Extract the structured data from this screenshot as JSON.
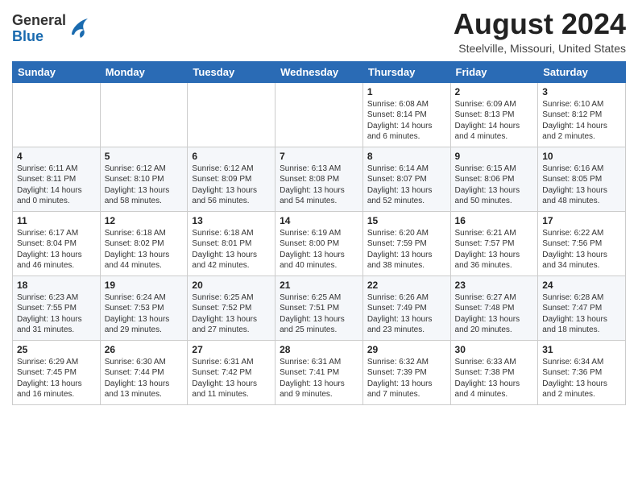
{
  "header": {
    "logo_general": "General",
    "logo_blue": "Blue",
    "title": "August 2024",
    "location": "Steelville, Missouri, United States"
  },
  "days_of_week": [
    "Sunday",
    "Monday",
    "Tuesday",
    "Wednesday",
    "Thursday",
    "Friday",
    "Saturday"
  ],
  "weeks": [
    [
      {
        "day": "",
        "text": ""
      },
      {
        "day": "",
        "text": ""
      },
      {
        "day": "",
        "text": ""
      },
      {
        "day": "",
        "text": ""
      },
      {
        "day": "1",
        "text": "Sunrise: 6:08 AM\nSunset: 8:14 PM\nDaylight: 14 hours and 6 minutes."
      },
      {
        "day": "2",
        "text": "Sunrise: 6:09 AM\nSunset: 8:13 PM\nDaylight: 14 hours and 4 minutes."
      },
      {
        "day": "3",
        "text": "Sunrise: 6:10 AM\nSunset: 8:12 PM\nDaylight: 14 hours and 2 minutes."
      }
    ],
    [
      {
        "day": "4",
        "text": "Sunrise: 6:11 AM\nSunset: 8:11 PM\nDaylight: 14 hours and 0 minutes."
      },
      {
        "day": "5",
        "text": "Sunrise: 6:12 AM\nSunset: 8:10 PM\nDaylight: 13 hours and 58 minutes."
      },
      {
        "day": "6",
        "text": "Sunrise: 6:12 AM\nSunset: 8:09 PM\nDaylight: 13 hours and 56 minutes."
      },
      {
        "day": "7",
        "text": "Sunrise: 6:13 AM\nSunset: 8:08 PM\nDaylight: 13 hours and 54 minutes."
      },
      {
        "day": "8",
        "text": "Sunrise: 6:14 AM\nSunset: 8:07 PM\nDaylight: 13 hours and 52 minutes."
      },
      {
        "day": "9",
        "text": "Sunrise: 6:15 AM\nSunset: 8:06 PM\nDaylight: 13 hours and 50 minutes."
      },
      {
        "day": "10",
        "text": "Sunrise: 6:16 AM\nSunset: 8:05 PM\nDaylight: 13 hours and 48 minutes."
      }
    ],
    [
      {
        "day": "11",
        "text": "Sunrise: 6:17 AM\nSunset: 8:04 PM\nDaylight: 13 hours and 46 minutes."
      },
      {
        "day": "12",
        "text": "Sunrise: 6:18 AM\nSunset: 8:02 PM\nDaylight: 13 hours and 44 minutes."
      },
      {
        "day": "13",
        "text": "Sunrise: 6:18 AM\nSunset: 8:01 PM\nDaylight: 13 hours and 42 minutes."
      },
      {
        "day": "14",
        "text": "Sunrise: 6:19 AM\nSunset: 8:00 PM\nDaylight: 13 hours and 40 minutes."
      },
      {
        "day": "15",
        "text": "Sunrise: 6:20 AM\nSunset: 7:59 PM\nDaylight: 13 hours and 38 minutes."
      },
      {
        "day": "16",
        "text": "Sunrise: 6:21 AM\nSunset: 7:57 PM\nDaylight: 13 hours and 36 minutes."
      },
      {
        "day": "17",
        "text": "Sunrise: 6:22 AM\nSunset: 7:56 PM\nDaylight: 13 hours and 34 minutes."
      }
    ],
    [
      {
        "day": "18",
        "text": "Sunrise: 6:23 AM\nSunset: 7:55 PM\nDaylight: 13 hours and 31 minutes."
      },
      {
        "day": "19",
        "text": "Sunrise: 6:24 AM\nSunset: 7:53 PM\nDaylight: 13 hours and 29 minutes."
      },
      {
        "day": "20",
        "text": "Sunrise: 6:25 AM\nSunset: 7:52 PM\nDaylight: 13 hours and 27 minutes."
      },
      {
        "day": "21",
        "text": "Sunrise: 6:25 AM\nSunset: 7:51 PM\nDaylight: 13 hours and 25 minutes."
      },
      {
        "day": "22",
        "text": "Sunrise: 6:26 AM\nSunset: 7:49 PM\nDaylight: 13 hours and 23 minutes."
      },
      {
        "day": "23",
        "text": "Sunrise: 6:27 AM\nSunset: 7:48 PM\nDaylight: 13 hours and 20 minutes."
      },
      {
        "day": "24",
        "text": "Sunrise: 6:28 AM\nSunset: 7:47 PM\nDaylight: 13 hours and 18 minutes."
      }
    ],
    [
      {
        "day": "25",
        "text": "Sunrise: 6:29 AM\nSunset: 7:45 PM\nDaylight: 13 hours and 16 minutes."
      },
      {
        "day": "26",
        "text": "Sunrise: 6:30 AM\nSunset: 7:44 PM\nDaylight: 13 hours and 13 minutes."
      },
      {
        "day": "27",
        "text": "Sunrise: 6:31 AM\nSunset: 7:42 PM\nDaylight: 13 hours and 11 minutes."
      },
      {
        "day": "28",
        "text": "Sunrise: 6:31 AM\nSunset: 7:41 PM\nDaylight: 13 hours and 9 minutes."
      },
      {
        "day": "29",
        "text": "Sunrise: 6:32 AM\nSunset: 7:39 PM\nDaylight: 13 hours and 7 minutes."
      },
      {
        "day": "30",
        "text": "Sunrise: 6:33 AM\nSunset: 7:38 PM\nDaylight: 13 hours and 4 minutes."
      },
      {
        "day": "31",
        "text": "Sunrise: 6:34 AM\nSunset: 7:36 PM\nDaylight: 13 hours and 2 minutes."
      }
    ]
  ]
}
